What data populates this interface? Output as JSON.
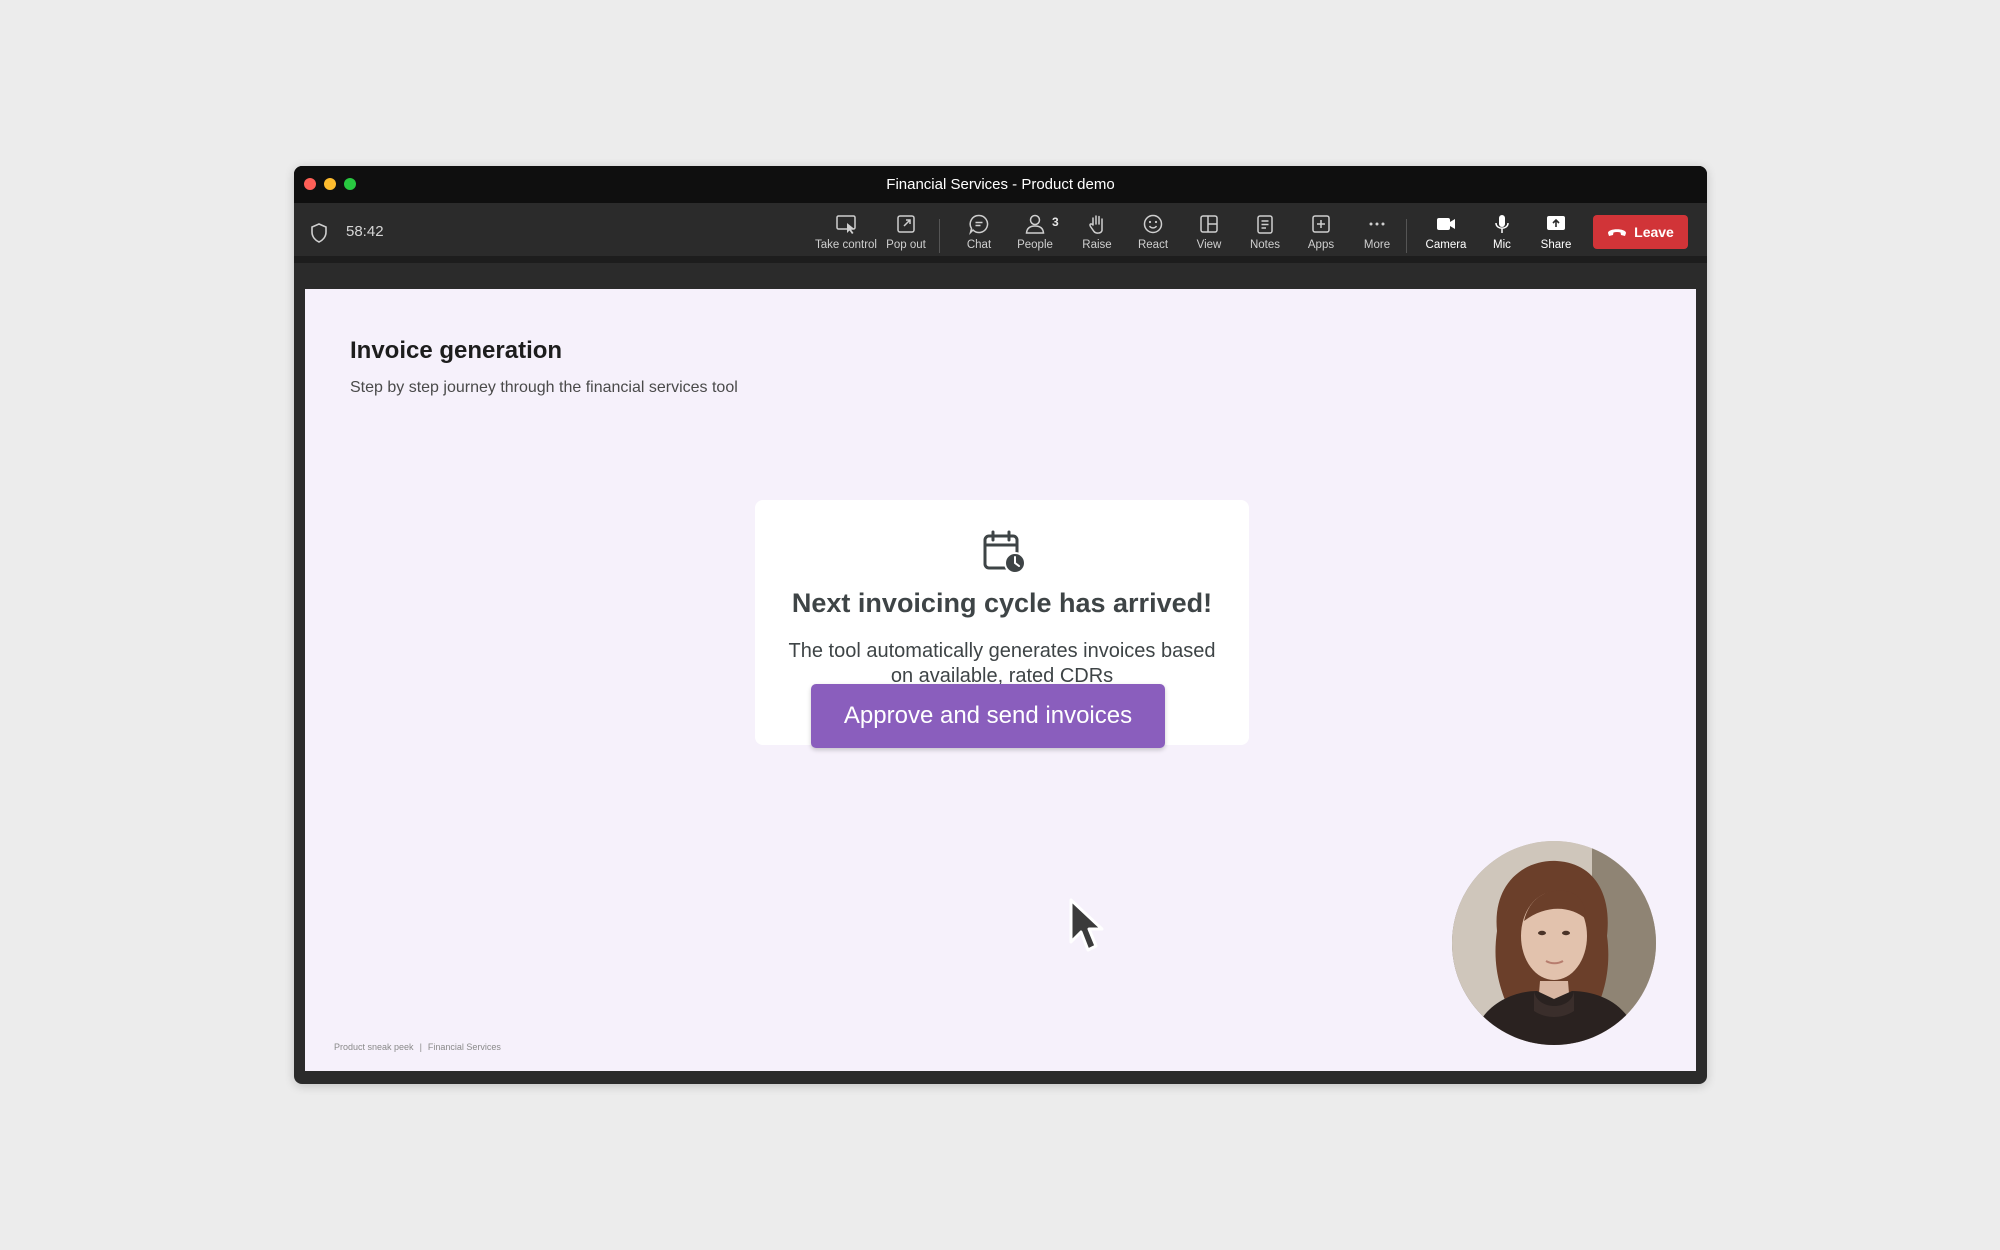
{
  "window": {
    "title": "Financial Services - Product demo"
  },
  "toolbar": {
    "timer": "58:42",
    "buttons": [
      {
        "label": "Take control",
        "icon": "take-control-icon"
      },
      {
        "label": "Pop out",
        "icon": "pop-out-icon"
      },
      {
        "label": "Chat",
        "icon": "chat-icon"
      },
      {
        "label": "People",
        "icon": "people-icon",
        "count": "3"
      },
      {
        "label": "Raise",
        "icon": "raise-hand-icon"
      },
      {
        "label": "React",
        "icon": "react-icon"
      },
      {
        "label": "View",
        "icon": "view-icon"
      },
      {
        "label": "Notes",
        "icon": "notes-icon"
      },
      {
        "label": "Apps",
        "icon": "apps-icon"
      },
      {
        "label": "More",
        "icon": "more-icon"
      },
      {
        "label": "Camera",
        "icon": "camera-icon"
      },
      {
        "label": "Mic",
        "icon": "mic-icon"
      },
      {
        "label": "Share",
        "icon": "share-icon"
      }
    ],
    "leave_label": "Leave"
  },
  "slide": {
    "title": "Invoice generation",
    "subtitle": "Step by step journey through the financial services tool",
    "card": {
      "icon": "calendar-clock-icon",
      "title": "Next invoicing cycle has arrived!",
      "body": "The tool automatically generates invoices based on available, rated CDRs"
    },
    "button_label": "Approve and send invoices",
    "footer": {
      "left": "Product sneak peek",
      "separator": "|",
      "right": "Financial Services"
    }
  },
  "colors": {
    "accent": "#8a5ebd",
    "leave": "#d13438",
    "stage_bg": "#f6f1fb"
  }
}
